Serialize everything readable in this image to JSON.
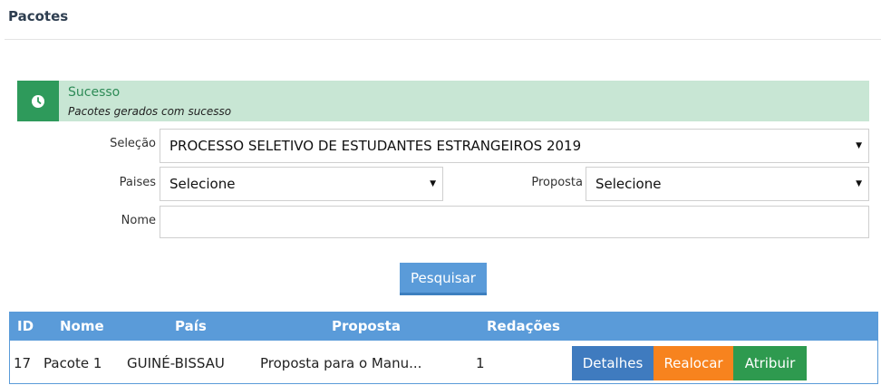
{
  "page": {
    "title": "Pacotes"
  },
  "alert": {
    "title": "Sucesso",
    "message": "Pacotes gerados com sucesso",
    "icon": "clock-icon"
  },
  "form": {
    "selecao_label": "Seleção",
    "selecao_value": "PROCESSO SELETIVO DE ESTUDANTES ESTRANGEIROS 2019",
    "paises_label": "Paises",
    "paises_value": "Selecione",
    "proposta_label": "Proposta",
    "proposta_value": "Selecione",
    "nome_label": "Nome",
    "nome_value": "",
    "search_button": "Pesquisar"
  },
  "table": {
    "headers": [
      "ID",
      "Nome",
      "País",
      "Proposta",
      "Redações"
    ],
    "rows": [
      {
        "id": "17",
        "nome": "Pacote 1",
        "pais": "GUINÉ-BISSAU",
        "proposta": "Proposta para o Manu...",
        "redacoes": "1",
        "actions": [
          "Detalhes",
          "Realocar",
          "Atribuir"
        ]
      }
    ]
  },
  "colors": {
    "primary": "#5a9bd9",
    "success": "#2e9a5b",
    "success_bg": "#c8e6d4",
    "warning": "#f7831e",
    "green": "#2e9a4f"
  }
}
